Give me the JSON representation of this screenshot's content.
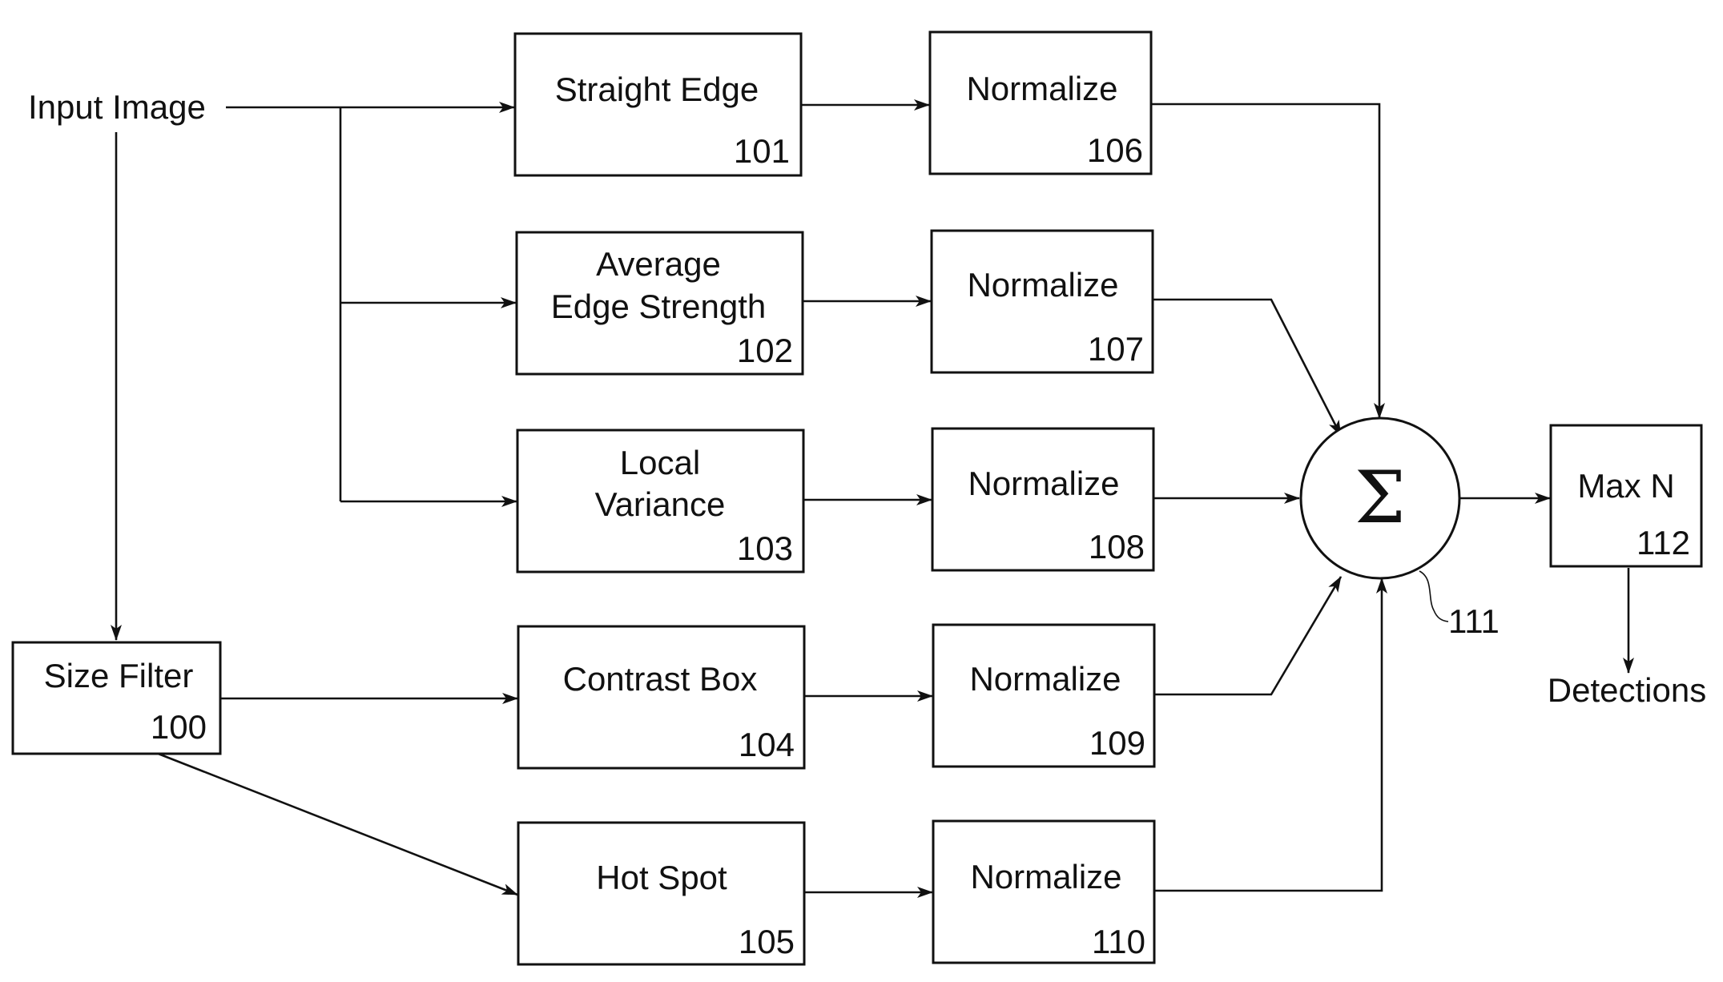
{
  "diagram": {
    "input_label": "Input Image",
    "output_label": "Detections",
    "sum_symbol": "Σ",
    "sum_ref": "111",
    "blocks": [
      {
        "id": "size-filter",
        "lines": [
          "Size Filter"
        ],
        "ref": "100"
      },
      {
        "id": "straight-edge",
        "lines": [
          "Straight Edge"
        ],
        "ref": "101"
      },
      {
        "id": "average-edge-strength",
        "lines": [
          "Average",
          "Edge Strength"
        ],
        "ref": "102"
      },
      {
        "id": "local-variance",
        "lines": [
          "Local",
          "Variance"
        ],
        "ref": "103"
      },
      {
        "id": "contrast-box",
        "lines": [
          "Contrast Box"
        ],
        "ref": "104"
      },
      {
        "id": "hot-spot",
        "lines": [
          "Hot Spot"
        ],
        "ref": "105"
      },
      {
        "id": "normalize-106",
        "lines": [
          "Normalize"
        ],
        "ref": "106"
      },
      {
        "id": "normalize-107",
        "lines": [
          "Normalize"
        ],
        "ref": "107"
      },
      {
        "id": "normalize-108",
        "lines": [
          "Normalize"
        ],
        "ref": "108"
      },
      {
        "id": "normalize-109",
        "lines": [
          "Normalize"
        ],
        "ref": "109"
      },
      {
        "id": "normalize-110",
        "lines": [
          "Normalize"
        ],
        "ref": "110"
      },
      {
        "id": "max-n",
        "lines": [
          "Max N"
        ],
        "ref": "112"
      }
    ]
  }
}
